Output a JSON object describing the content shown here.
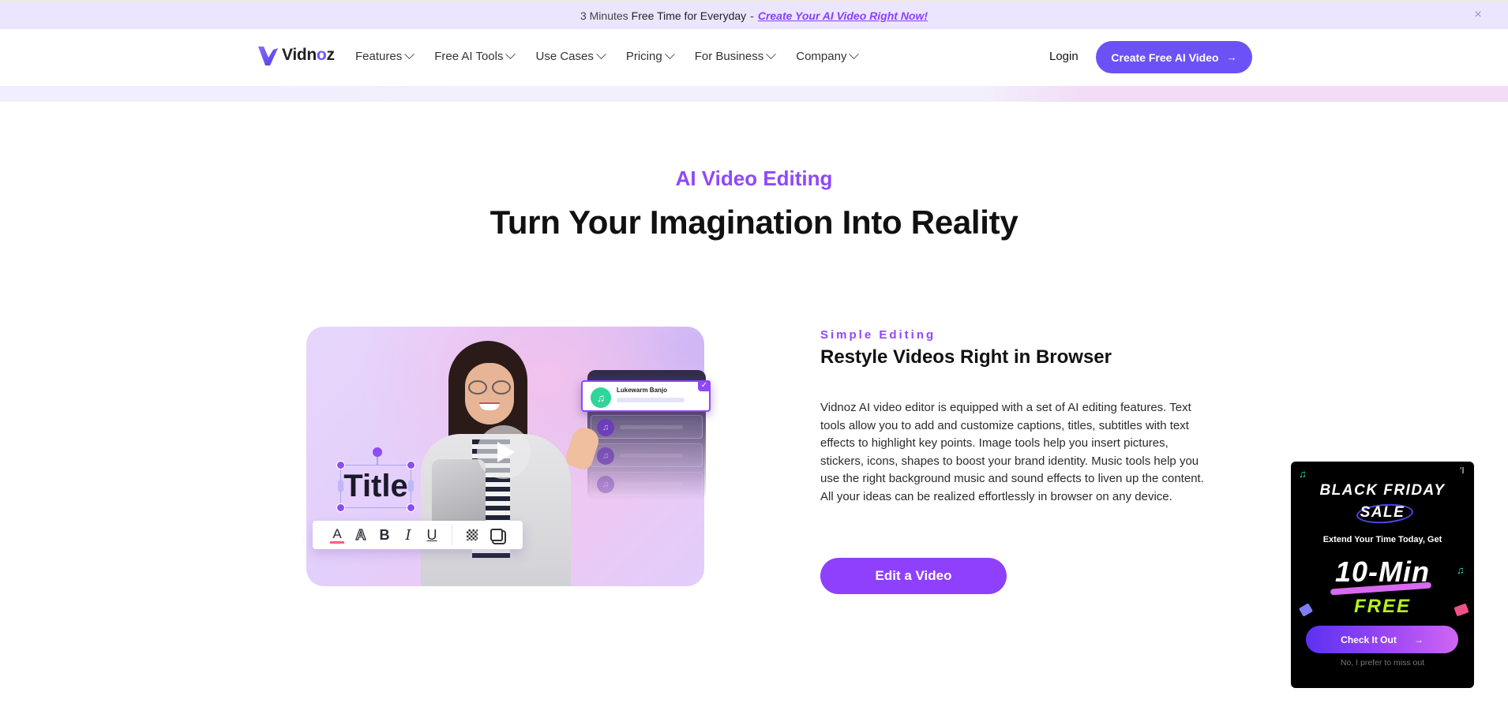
{
  "announcement": {
    "lead_light": "3 Minutes",
    "lead_dark": "Free Time for Everyday",
    "separator": "-",
    "link": "Create Your AI Video Right Now!",
    "close_icon": "×"
  },
  "header": {
    "logo": {
      "text_before": "Vidn",
      "text_o": "o",
      "text_after": "z"
    },
    "nav": [
      {
        "label": "Features"
      },
      {
        "label": "Free AI Tools"
      },
      {
        "label": "Use Cases"
      },
      {
        "label": "Pricing"
      },
      {
        "label": "For Business"
      },
      {
        "label": "Company"
      }
    ],
    "login": "Login",
    "cta": "Create Free AI Video",
    "cta_arrow": "→"
  },
  "section": {
    "eyebrow": "AI Video Editing",
    "headline": "Turn Your Imagination Into Reality"
  },
  "illustration": {
    "title_text": "Title",
    "music_track": "Lukewarm Banjo",
    "music_icon": "♫",
    "check_icon": "✓",
    "toolbar": {
      "font_color": "A",
      "outline": "A",
      "bold": "B",
      "italic": "I",
      "underline": "U"
    }
  },
  "feature": {
    "eyebrow": "Simple Editing",
    "title": "Restyle Videos Right in Browser",
    "body": "Vidnoz AI video editor is equipped with a set of AI editing features. Text tools allow you to add and customize captions, titles, subtitles with text effects to highlight key points. Image tools help you insert pictures, stickers, icons, shapes to boost your brand identity. Music tools help you use the right background music and sound effects to liven up the content. All your ideas can be realized effortlessly in browser on any device.",
    "cta": "Edit a Video"
  },
  "promo": {
    "line1": "BLACK FRIDAY",
    "line2": "SALE",
    "subtitle": "Extend Your Time Today, Get",
    "big": "10-Min",
    "free": "FREE",
    "cta": "Check It Out",
    "cta_arrow": "→",
    "dismiss": "No, I prefer to miss out",
    "music_note": "♫"
  },
  "colors": {
    "brand": "#6c52f6",
    "accent_purple": "#8f48fb",
    "promo_green": "#b7f21a"
  }
}
